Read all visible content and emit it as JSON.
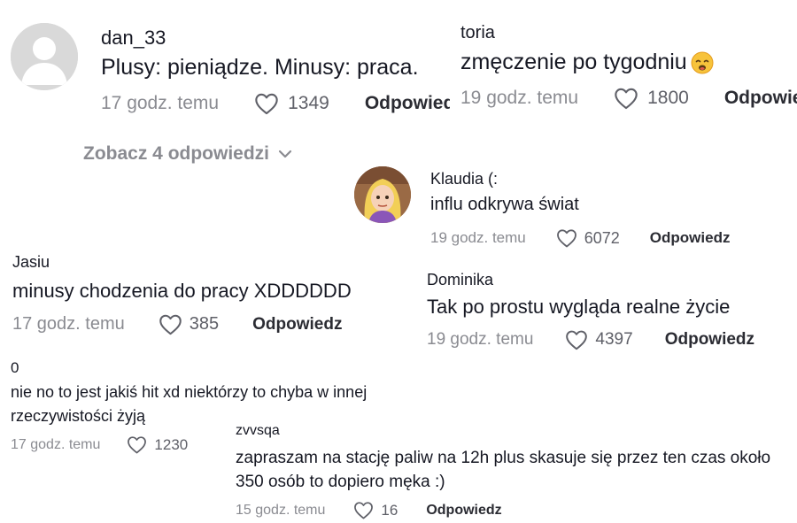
{
  "comments": [
    {
      "username": "dan_33",
      "avatar": "default-avatar",
      "text": "Plusy: pieniądze. Minusy: praca.",
      "time": "17 godz. temu",
      "likes": "1349",
      "reply_label": "Odpowiedz"
    },
    {
      "username": "toria",
      "text": "zmęczenie po tygodniu",
      "emoji": "tired-face-emoji",
      "time": "19 godz. temu",
      "likes": "1800",
      "reply_label": "Odpowiedz"
    },
    {
      "username": "Klaudia (:",
      "avatar": "cartoon-girl-avatar",
      "text": "influ odkrywa świat",
      "time": "19 godz. temu",
      "likes": "6072",
      "reply_label": "Odpowiedz"
    },
    {
      "username": "Jasiu",
      "text": "minusy chodzenia do pracy XDDDDDD",
      "time": "17 godz. temu",
      "likes": "385",
      "reply_label": "Odpowiedz"
    },
    {
      "username": "Dominika",
      "text": "Tak po prostu wygląda realne życie",
      "time": "19 godz. temu",
      "likes": "4397",
      "reply_label": "Odpowiedz"
    },
    {
      "username": "0",
      "text": "nie no to jest jakiś hit xd niektórzy to chyba w innej rzeczywistości żyją",
      "time": "17 godz. temu",
      "likes": "1230"
    },
    {
      "username": "zvvsqa",
      "text": "zapraszam na stację paliw na 12h plus skasuje się przez ten czas około 350 osób to dopiero męka :)",
      "time": "15 godz. temu",
      "likes": "16",
      "reply_label": "Odpowiedz"
    }
  ],
  "see_replies_label": "Zobacz 4 odpowiedzi",
  "colors": {
    "text": "#161823",
    "muted": "#8a8b91",
    "background": "#ffffff"
  },
  "icons": {
    "like": "heart-outline-icon",
    "expand": "chevron-down-icon"
  }
}
